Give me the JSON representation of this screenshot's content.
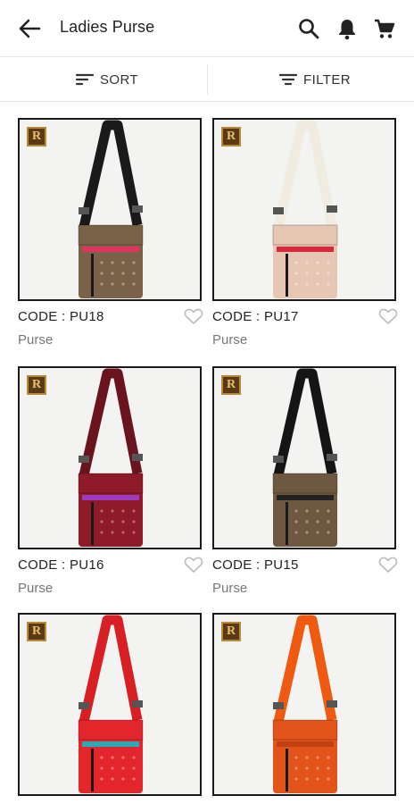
{
  "header": {
    "title": "Ladies Purse",
    "back_icon": "arrow-left-icon",
    "actions": [
      "search-icon",
      "bell-icon",
      "cart-icon"
    ]
  },
  "toolbar": {
    "sort_label": "SORT",
    "filter_label": "FILTER"
  },
  "products": [
    {
      "code": "CODE : PU18",
      "category": "Purse",
      "strap": "#1a1a1a",
      "body": "#7a6248",
      "accent": "#e0335f"
    },
    {
      "code": "CODE : PU17",
      "category": "Purse",
      "strap": "#f1ece2",
      "body": "#e8c6b4",
      "accent": "#d8283c"
    },
    {
      "code": "CODE : PU16",
      "category": "Purse",
      "strap": "#6a1420",
      "body": "#8f1a28",
      "accent": "#9b3cc0"
    },
    {
      "code": "CODE : PU15",
      "category": "Purse",
      "strap": "#151515",
      "body": "#6e5840",
      "accent": "#222222"
    },
    {
      "code": "",
      "category": "",
      "strap": "#d71f24",
      "body": "#e2262c",
      "accent": "#2aa9b8"
    },
    {
      "code": "",
      "category": "",
      "strap": "#ef5a10",
      "body": "#e2541a",
      "accent": "#c04010"
    }
  ],
  "brand_logo_letter": "R"
}
